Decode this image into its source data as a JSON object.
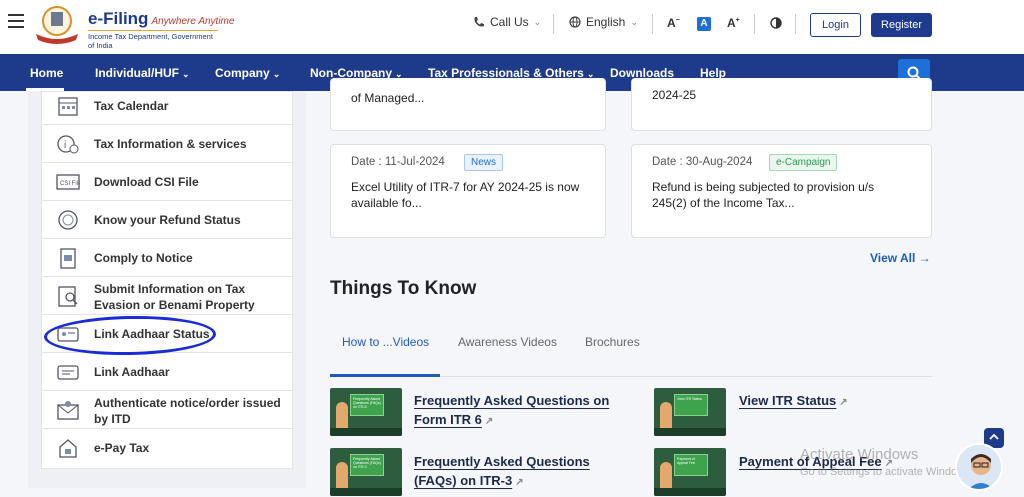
{
  "header": {
    "brand_title": "e-Filing",
    "brand_tagline": "Anywhere Anytime",
    "brand_subtitle": "Income Tax Department, Government of India",
    "call_us": "Call Us",
    "language": "English",
    "font_smaller": "A",
    "font_default": "A",
    "font_larger": "A",
    "login": "Login",
    "register": "Register"
  },
  "nav": {
    "items": [
      {
        "label": "Home"
      },
      {
        "label": "Individual/HUF"
      },
      {
        "label": "Company"
      },
      {
        "label": "Non-Company"
      },
      {
        "label": "Tax Professionals & Others"
      },
      {
        "label": "Downloads"
      },
      {
        "label": "Help"
      }
    ]
  },
  "sidebar": {
    "items": [
      {
        "label": "Tax Calendar"
      },
      {
        "label": "Tax Information & services"
      },
      {
        "label": "Download CSI File"
      },
      {
        "label": "Know your Refund Status"
      },
      {
        "label": "Comply to Notice"
      },
      {
        "label": "Submit Information on Tax Evasion or Benami Property"
      },
      {
        "label": "Link Aadhaar Status"
      },
      {
        "label": "Link Aadhaar"
      },
      {
        "label": "Authenticate notice/order issued by ITD"
      },
      {
        "label": "e-Pay Tax"
      }
    ]
  },
  "news": {
    "top_left_text": "of Managed...",
    "top_right_text": "2024-25",
    "cards": [
      {
        "date": "Date : 11-Jul-2024",
        "badge": "News",
        "text": "Excel Utility of ITR-7 for AY 2024-25 is now available fo..."
      },
      {
        "date": "Date : 30-Aug-2024",
        "badge": "e-Campaign",
        "text": "Refund is being subjected to provision u/s 245(2) of the Income Tax..."
      }
    ],
    "view_all": "View All"
  },
  "things_to_know": {
    "title": "Things To Know",
    "tabs": [
      {
        "label": "How to ...Videos"
      },
      {
        "label": "Awareness Videos"
      },
      {
        "label": "Brochures"
      }
    ],
    "videos": [
      {
        "title": "Frequently Asked Questions on Form ITR 6",
        "thumb_text": "Frequently Asked Questions (FAQs) on ITR-6"
      },
      {
        "title": "View ITR Status",
        "thumb_text": "View ITR Status"
      },
      {
        "title": "Frequently Asked Questions (FAQs) on ITR-3",
        "thumb_text": "Frequently Asked Questions (FAQs) on ITR-3"
      },
      {
        "title": "Payment of Appeal Fee",
        "thumb_text": "Payment of Appeal Fee"
      }
    ]
  },
  "watermark": {
    "line1": "Activate Windows",
    "line2": "Go to Settings to activate Windows."
  },
  "colors": {
    "nav_bg": "#1e3a8a",
    "accent": "#1e6fd9",
    "highlight_circle": "#1a2bd8",
    "news_badge": "#1e6fd9",
    "campaign_badge": "#2e9b4f"
  }
}
